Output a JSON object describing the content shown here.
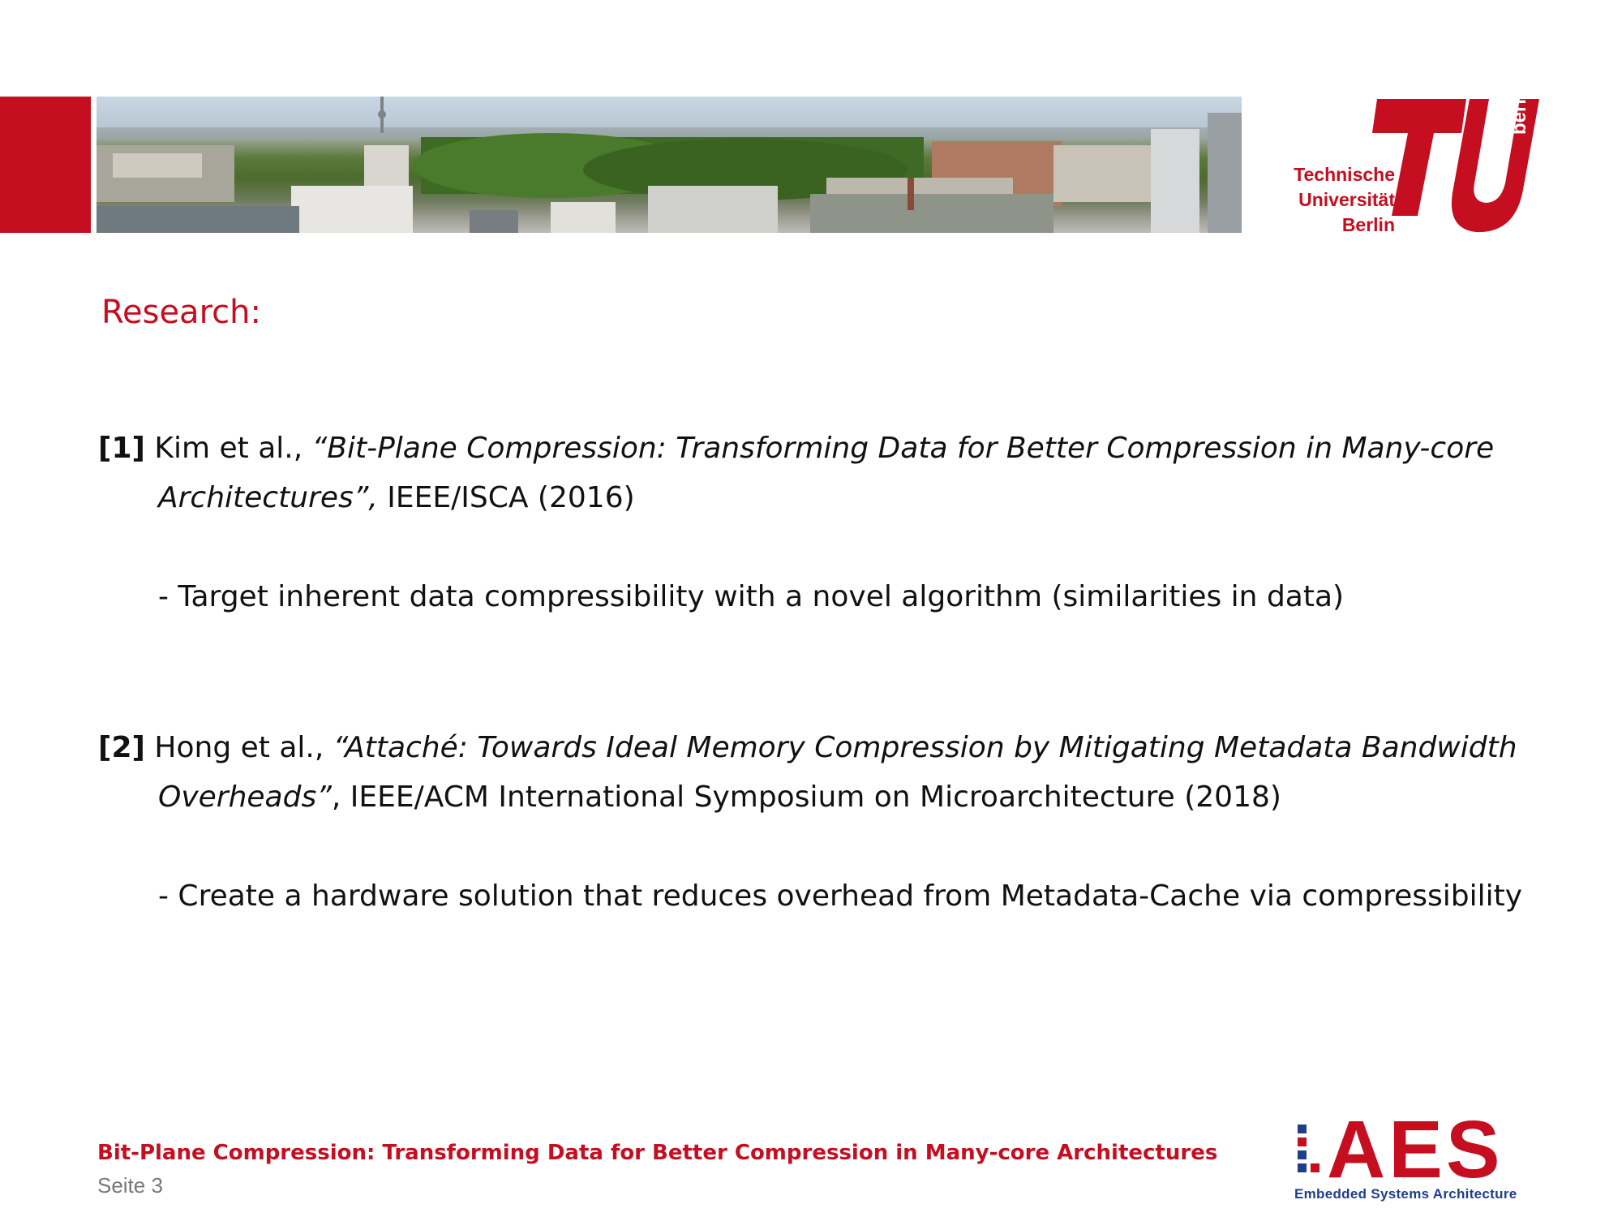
{
  "header": {
    "banner_image": "berlin-city-panorama",
    "logo": {
      "line1": "Technische",
      "line2": "Universität",
      "line3": "Berlin",
      "vertical": "berlin"
    }
  },
  "slide": {
    "heading": "Research:",
    "references": [
      {
        "number": "[1]",
        "authors": " Kim et al., ",
        "title_line1": "“Bit-Plane Compression: Transforming Data for Better Compression in Many-core",
        "title_line2": "Architectures”,",
        "venue": " IEEE/ISCA (2016)",
        "bullet": "- Target inherent data compressibility with a novel algorithm (similarities in data)"
      },
      {
        "number": "[2]",
        "authors": " Hong et al., ",
        "title_line1": "“Attaché: Towards Ideal Memory Compression by Mitigating Metadata Bandwidth",
        "title_line2": "Overheads”",
        "venue": ", IEEE/ACM International Symposium on Microarchitecture (2018)",
        "bullet": "- Create a hardware solution that reduces overhead from Metadata-Cache via compressibility"
      }
    ]
  },
  "footer": {
    "title": "Bit-Plane Compression: Transforming Data for Better Compression in Many-core Architectures",
    "page": "Seite 3",
    "aes_logo": {
      "word": "AES",
      "subtitle": "Embedded Systems Architecture"
    }
  },
  "colors": {
    "accent_red": "#c50e1f",
    "aes_blue": "#1f3d8a",
    "text": "#111111",
    "page_number": "#777777"
  }
}
